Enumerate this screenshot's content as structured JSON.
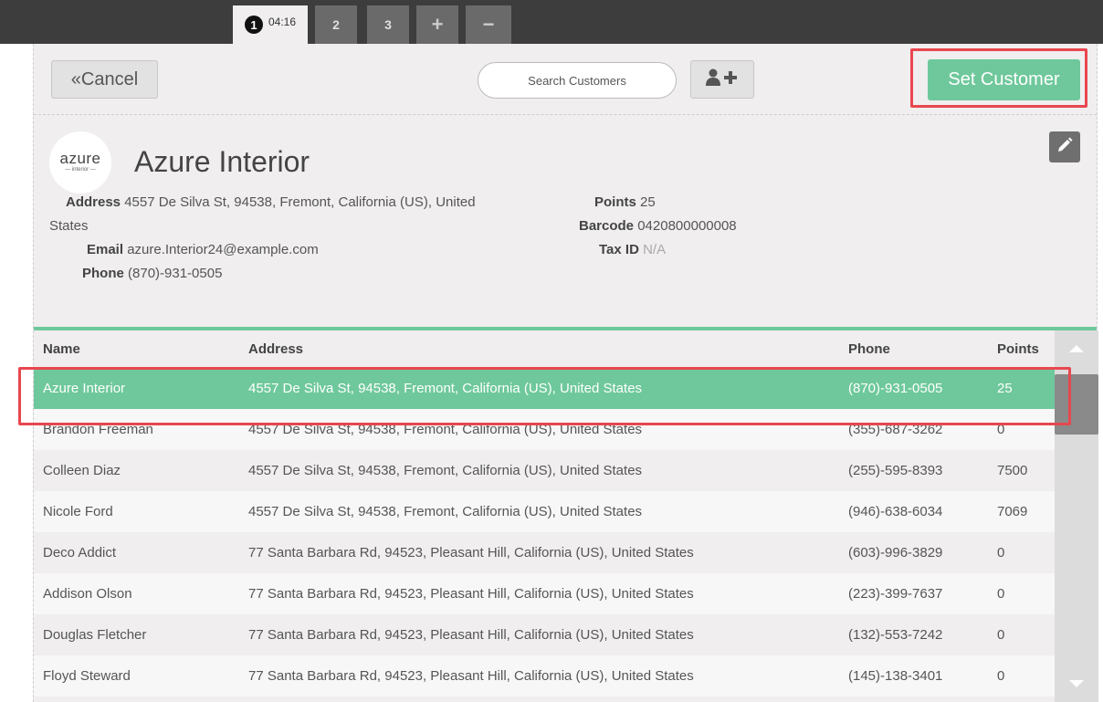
{
  "order_tabs": [
    {
      "number": "1",
      "time": "04:16"
    },
    {
      "number": "2"
    },
    {
      "number": "3"
    }
  ],
  "order_controls": {
    "add": "+",
    "remove": "−"
  },
  "header": {
    "cancel_label": "«Cancel",
    "search_placeholder": "Search Customers",
    "set_customer_label": "Set Customer"
  },
  "customer": {
    "name": "Azure Interior",
    "logo_main": "azure",
    "logo_sub": "— interior —",
    "address_label": "Address",
    "address": "4557 De Silva St, 94538, Fremont, California (US), United",
    "address_cont": "States",
    "email_label": "Email",
    "email": "azure.Interior24@example.com",
    "phone_label": "Phone",
    "phone": "(870)-931-0505",
    "points_label": "Points",
    "points": "25",
    "barcode_label": "Barcode",
    "barcode": "0420800000008",
    "taxid_label": "Tax ID",
    "taxid": "N/A"
  },
  "table": {
    "headers": {
      "name": "Name",
      "address": "Address",
      "phone": "Phone",
      "points": "Points"
    },
    "rows": [
      {
        "name": "Azure Interior",
        "address": "4557 De Silva St, 94538, Fremont, California (US), United States",
        "phone": "(870)-931-0505",
        "points": "25"
      },
      {
        "name": "Brandon Freeman",
        "address": "4557 De Silva St, 94538, Fremont, California (US), United States",
        "phone": "(355)-687-3262",
        "points": "0"
      },
      {
        "name": "Colleen Diaz",
        "address": "4557 De Silva St, 94538, Fremont, California (US), United States",
        "phone": "(255)-595-8393",
        "points": "7500"
      },
      {
        "name": "Nicole Ford",
        "address": "4557 De Silva St, 94538, Fremont, California (US), United States",
        "phone": "(946)-638-6034",
        "points": "7069"
      },
      {
        "name": "Deco Addict",
        "address": "77 Santa Barbara Rd, 94523, Pleasant Hill, California (US), United States",
        "phone": "(603)-996-3829",
        "points": "0"
      },
      {
        "name": "Addison Olson",
        "address": "77 Santa Barbara Rd, 94523, Pleasant Hill, California (US), United States",
        "phone": "(223)-399-7637",
        "points": "0"
      },
      {
        "name": "Douglas Fletcher",
        "address": "77 Santa Barbara Rd, 94523, Pleasant Hill, California (US), United States",
        "phone": "(132)-553-7242",
        "points": "0"
      },
      {
        "name": "Floyd Steward",
        "address": "77 Santa Barbara Rd, 94523, Pleasant Hill, California (US), United States",
        "phone": "(145)-138-3401",
        "points": "0"
      }
    ]
  },
  "icons": {
    "add_customer": "user-plus-icon",
    "edit": "pencil-icon",
    "scroll_up": "triangle-up-icon",
    "scroll_down": "triangle-down-icon"
  },
  "colors": {
    "accent": "#6ec89b",
    "highlight": "#e8474f",
    "topbar": "#3d3d3d",
    "panel": "#f0eeee"
  }
}
